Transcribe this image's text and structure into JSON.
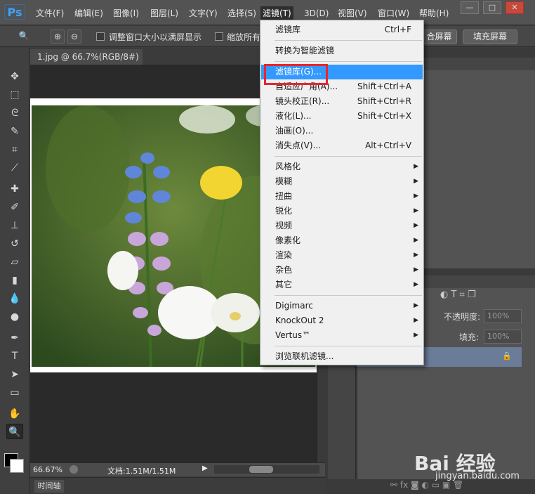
{
  "app": {
    "logo": "Ps",
    "menus": [
      "文件(F)",
      "编辑(E)",
      "图像(I)",
      "图层(L)",
      "文字(Y)",
      "选择(S)",
      "滤镜(T)",
      "3D(D)",
      "视图(V)",
      "窗口(W)",
      "帮助(H)"
    ],
    "window_controls": [
      "—",
      "□",
      "✕"
    ]
  },
  "options_bar": {
    "checkbox1_label": "调整窗口大小以满屏显示",
    "checkbox2_label": "缩放所有",
    "btn_fit": "合屏幕",
    "btn_fill": "填充屏幕"
  },
  "document": {
    "tab_title": "1.jpg @ 66.7%(RGB/8#)",
    "zoom": "66.67%",
    "doc_info": "文档:1.51M/1.51M",
    "timeline_label": "时间轴"
  },
  "filter_menu": {
    "items": [
      {
        "label": "滤镜库",
        "shortcut": "Ctrl+F"
      },
      {
        "label": "转换为智能滤镜"
      },
      {
        "label": "滤镜库(G)..."
      },
      {
        "label": "自适应广角(A)...",
        "shortcut": "Shift+Ctrl+A"
      },
      {
        "label": "镜头校正(R)...",
        "shortcut": "Shift+Ctrl+R"
      },
      {
        "label": "液化(L)...",
        "shortcut": "Shift+Ctrl+X"
      },
      {
        "label": "油画(O)..."
      },
      {
        "label": "消失点(V)...",
        "shortcut": "Alt+Ctrl+V"
      },
      {
        "label": "风格化"
      },
      {
        "label": "模糊"
      },
      {
        "label": "扭曲"
      },
      {
        "label": "锐化"
      },
      {
        "label": "视频"
      },
      {
        "label": "像素化"
      },
      {
        "label": "渲染"
      },
      {
        "label": "杂色"
      },
      {
        "label": "其它"
      },
      {
        "label": "Digimarc"
      },
      {
        "label": "KnockOut 2"
      },
      {
        "label": "Vertus™"
      },
      {
        "label": "浏览联机滤镜..."
      }
    ]
  },
  "layers_panel": {
    "opacity_label": "不透明度:",
    "opacity_value": "100%",
    "fill_label": "填充:",
    "fill_value": "100%"
  },
  "watermark": {
    "brand": "Bai 经验",
    "url": "jingyan.baidu.com"
  },
  "colors": {
    "menu_highlight": "#3399ff",
    "annotation_box": "#e8272b",
    "layer_selected": "#6b7c99"
  }
}
